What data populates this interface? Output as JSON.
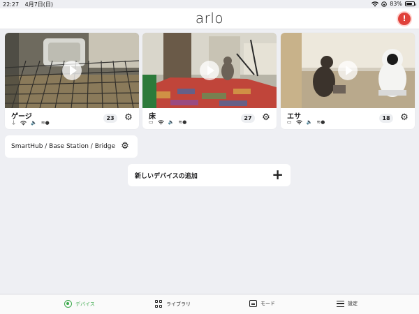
{
  "status_bar": {
    "time": "22:27",
    "date": "4月7日(日)",
    "battery": "83%",
    "battery_level": 0.83
  },
  "header": {
    "logo": "arlo",
    "alert_glyph": "!"
  },
  "cameras": [
    {
      "name": "ゲージ",
      "count": "23"
    },
    {
      "name": "床",
      "count": "27"
    },
    {
      "name": "エサ",
      "count": "18"
    }
  ],
  "hub": {
    "label": "SmartHub / Base Station / Bridge"
  },
  "add_device": {
    "label": "新しいデバイスの追加",
    "plus": "+"
  },
  "tabs": [
    {
      "label": "デバイス",
      "icon": "devices-icon",
      "active": true
    },
    {
      "label": "ライブラリ",
      "icon": "library-grid-icon",
      "active": false
    },
    {
      "label": "モード",
      "icon": "mode-icon",
      "active": false
    },
    {
      "label": "設定",
      "icon": "settings-menu-icon",
      "active": false
    }
  ],
  "colors": {
    "accent": "#3aa84a",
    "alert": "#e0413a",
    "background": "#eeeff3"
  }
}
